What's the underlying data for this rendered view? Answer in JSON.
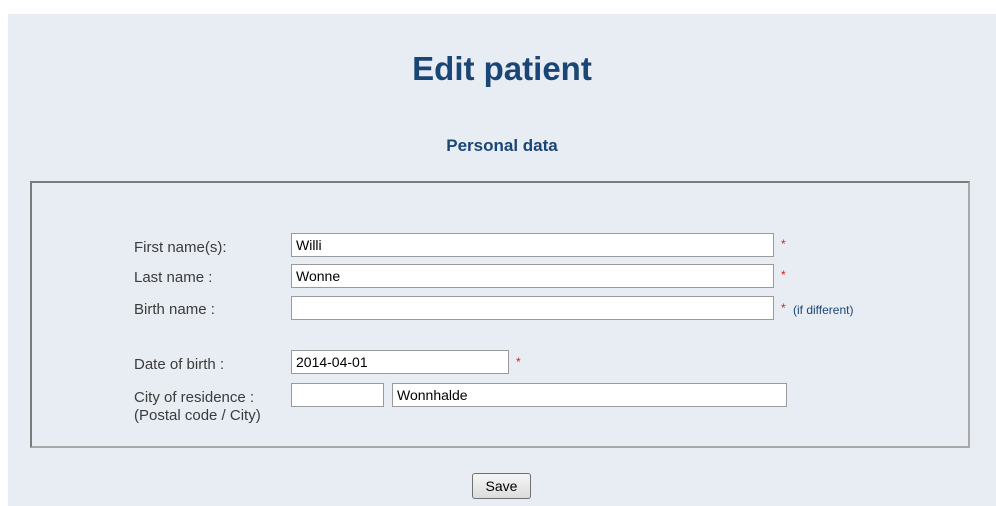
{
  "header": {
    "title": "Edit patient",
    "section_title": "Personal data"
  },
  "form": {
    "first_name": {
      "label": "First name(s):",
      "value": "Willi",
      "required": "*"
    },
    "last_name": {
      "label": "Last name :",
      "value": "Wonne",
      "required": "*"
    },
    "birth_name": {
      "label": "Birth name :",
      "value": "",
      "required": "*",
      "hint": "(if different)"
    },
    "date_of_birth": {
      "label": "Date of birth :",
      "value": "2014-04-01",
      "required": "*"
    },
    "residence": {
      "label": "City of residence :",
      "sublabel": "(Postal code / City)",
      "postal_code": "",
      "city": "Wonnhalde"
    }
  },
  "actions": {
    "save_label": "Save"
  },
  "colors": {
    "heading": "#1a4676",
    "required": "#d42020",
    "background": "#e8ecf3"
  }
}
